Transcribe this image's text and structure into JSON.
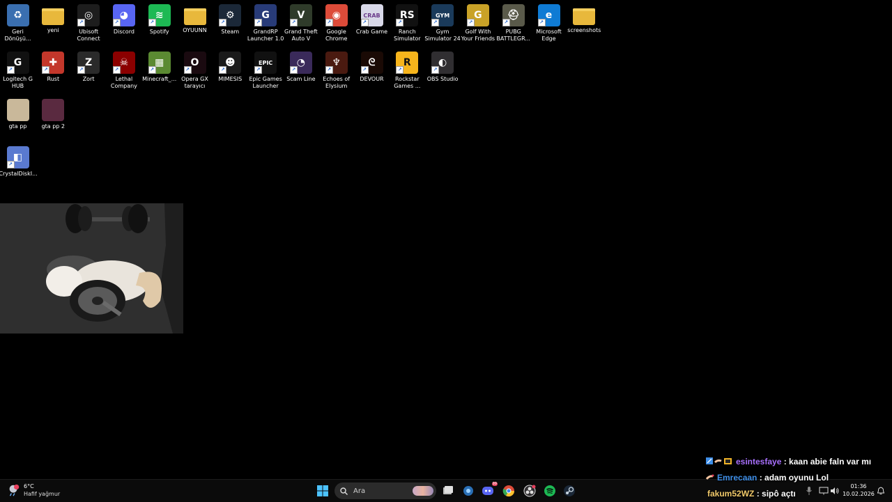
{
  "desktop": {
    "row1": [
      {
        "label": "Geri Dönüşü...",
        "icon": "recycle-bin-icon",
        "color": "#3a6fb0",
        "glyph": "♻"
      },
      {
        "label": "yeni",
        "icon": "folder-icon",
        "color": "#e8b83c",
        "glyph": ""
      },
      {
        "label": "Ubisoft Connect",
        "icon": "ubisoft-icon",
        "color": "#1d1d1d",
        "glyph": "◎"
      },
      {
        "label": "Discord",
        "icon": "discord-icon",
        "color": "#5865f2",
        "glyph": "◕"
      },
      {
        "label": "Spotify",
        "icon": "spotify-icon",
        "color": "#1db954",
        "glyph": "≋"
      },
      {
        "label": "OYUUNN",
        "icon": "folder-icon",
        "color": "#e8b83c",
        "glyph": ""
      },
      {
        "label": "Steam",
        "icon": "steam-icon",
        "color": "#1b2838",
        "glyph": "⚙"
      },
      {
        "label": "GrandRP Launcher 1.0",
        "icon": "grandrp-icon",
        "color": "#283b78",
        "glyph": "G"
      },
      {
        "label": "Grand Theft Auto V",
        "icon": "gta-icon",
        "color": "#2f3b2a",
        "glyph": "V"
      },
      {
        "label": "Google Chrome",
        "icon": "chrome-icon",
        "color": "#dd4b39",
        "glyph": "◉"
      },
      {
        "label": "Crab Game",
        "icon": "crab-game-icon",
        "color": "#d8d8e8",
        "glyph": "CRAB"
      },
      {
        "label": "Ranch Simulator",
        "icon": "ranch-simulator-icon",
        "color": "#111111",
        "glyph": "RS"
      },
      {
        "label": "Gym Simulator 24",
        "icon": "gym-simulator-icon",
        "color": "#1a3a5a",
        "glyph": "GYM"
      },
      {
        "label": "Golf With Your Friends",
        "icon": "golf-icon",
        "color": "#c9a227",
        "glyph": "G"
      },
      {
        "label": "PUBG BATTLEGR...",
        "icon": "pubg-icon",
        "color": "#5a5a4a",
        "glyph": "⛑"
      },
      {
        "label": "Microsoft Edge",
        "icon": "edge-icon",
        "color": "#0f7bd4",
        "glyph": "e"
      },
      {
        "label": "screenshots",
        "icon": "folder-icon",
        "color": "#e8b83c",
        "glyph": ""
      }
    ],
    "row2": [
      {
        "label": "Logitech G HUB",
        "icon": "logitech-icon",
        "color": "#111111",
        "glyph": "G"
      },
      {
        "label": "Rust",
        "icon": "rust-icon",
        "color": "#c3372b",
        "glyph": "✚"
      },
      {
        "label": "Zort",
        "icon": "zort-icon",
        "color": "#2a2a2a",
        "glyph": "Z"
      },
      {
        "label": "Lethal Company",
        "icon": "lethal-company-icon",
        "color": "#8b0000",
        "glyph": "☠"
      },
      {
        "label": "Minecraft_...",
        "icon": "minecraft-icon",
        "color": "#5b8a32",
        "glyph": "▦"
      },
      {
        "label": "Opera GX tarayıcı",
        "icon": "opera-gx-icon",
        "color": "#1a0a10",
        "glyph": "O"
      },
      {
        "label": "MIMESIS",
        "icon": "mimesis-icon",
        "color": "#1a1a1a",
        "glyph": "☻"
      },
      {
        "label": "Epic Games Launcher",
        "icon": "epic-games-icon",
        "color": "#111111",
        "glyph": "EPIC"
      },
      {
        "label": "Scam Line",
        "icon": "scam-line-icon",
        "color": "#3a2a5a",
        "glyph": "◔"
      },
      {
        "label": "Echoes of Elysium",
        "icon": "echoes-icon",
        "color": "#4a1a10",
        "glyph": "♆"
      },
      {
        "label": "DEVOUR",
        "icon": "devour-icon",
        "color": "#1a0a05",
        "glyph": "ᘓ"
      },
      {
        "label": "Rockstar Games ...",
        "icon": "rockstar-icon",
        "color": "#f7b51c",
        "glyph": "R"
      },
      {
        "label": "OBS Studio",
        "icon": "obs-icon",
        "color": "#302e31",
        "glyph": "◐"
      }
    ],
    "row3": [
      {
        "label": "gta pp",
        "icon": "image-thumbnail-icon",
        "color": "#c9b89a",
        "glyph": ""
      },
      {
        "label": "gta pp 2",
        "icon": "image-thumbnail-icon",
        "color": "#5a2a40",
        "glyph": ""
      }
    ],
    "row4": [
      {
        "label": "CrystalDiskI...",
        "icon": "crystaldisk-icon",
        "color": "#5a7ad0",
        "glyph": "◧"
      }
    ]
  },
  "taskbar": {
    "weather_temp": "6°C",
    "weather_desc": "Hafif yağmur",
    "search_placeholder": "Ara",
    "discord_badge": "99",
    "clock_time": "01:36",
    "clock_date": "10.02.2026"
  },
  "chat": [
    {
      "user": "esintesfaye",
      "user_color": "#a970ff",
      "message": "kaan abie faln var mı"
    },
    {
      "user": "Emrecaan",
      "user_color": "#3f8fe8",
      "message": "adam oyunu Lol"
    },
    {
      "user": "fakum52WZ",
      "user_color": "#f0c96a",
      "message": "sipô açtı"
    }
  ]
}
